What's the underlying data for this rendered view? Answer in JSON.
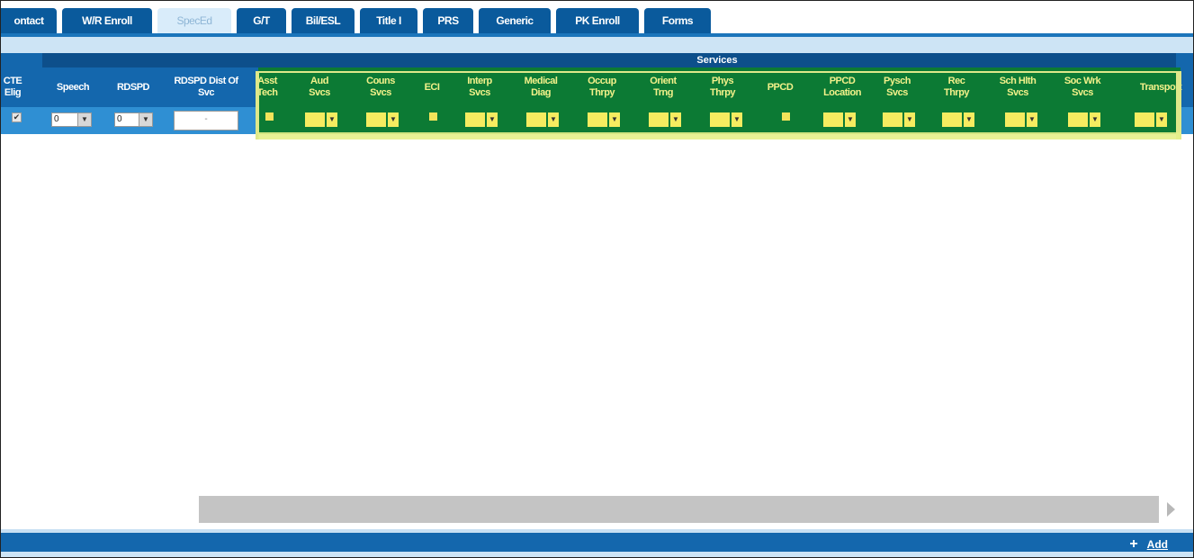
{
  "tabs": [
    {
      "label": "ontact"
    },
    {
      "label": "W/R Enroll"
    },
    {
      "label": "SpecEd"
    },
    {
      "label": "G/T"
    },
    {
      "label": "Bil/ESL"
    },
    {
      "label": "Title I"
    },
    {
      "label": "PRS"
    },
    {
      "label": "Generic"
    },
    {
      "label": "PK Enroll"
    },
    {
      "label": "Forms"
    }
  ],
  "active_tab": "SpecEd",
  "grid": {
    "group_header": "Services",
    "columns": [
      {
        "label": "CTE Elig"
      },
      {
        "label": "Speech"
      },
      {
        "label": "RDSPD"
      },
      {
        "label": "RDSPD Dist Of Svc"
      },
      {
        "label": "Asst Tech"
      },
      {
        "label": "Aud Svcs"
      },
      {
        "label": "Couns Svcs"
      },
      {
        "label": "ECI"
      },
      {
        "label": "Interp Svcs"
      },
      {
        "label": "Medical Diag"
      },
      {
        "label": "Occup Thrpy"
      },
      {
        "label": "Orient Trng"
      },
      {
        "label": "Phys Thrpy"
      },
      {
        "label": "PPCD"
      },
      {
        "label": "PPCD Location"
      },
      {
        "label": "Pysch Svcs"
      },
      {
        "label": "Rec Thrpy"
      },
      {
        "label": "Sch Hlth Svcs"
      },
      {
        "label": "Soc Wrk Svcs"
      },
      {
        "label": "Transport"
      }
    ],
    "row": {
      "cte_elig_checked": true,
      "speech_value": "0",
      "rdspd_value": "0",
      "dist_of_svc_value": "-"
    }
  },
  "footer": {
    "add_label": "Add",
    "add_icon": "plus-icon"
  },
  "colors": {
    "tab_blue": "#0a5a9c",
    "header_blue": "#1467ad",
    "services_green": "#0c7a34",
    "highlight_yellow": "#f6ec60"
  }
}
